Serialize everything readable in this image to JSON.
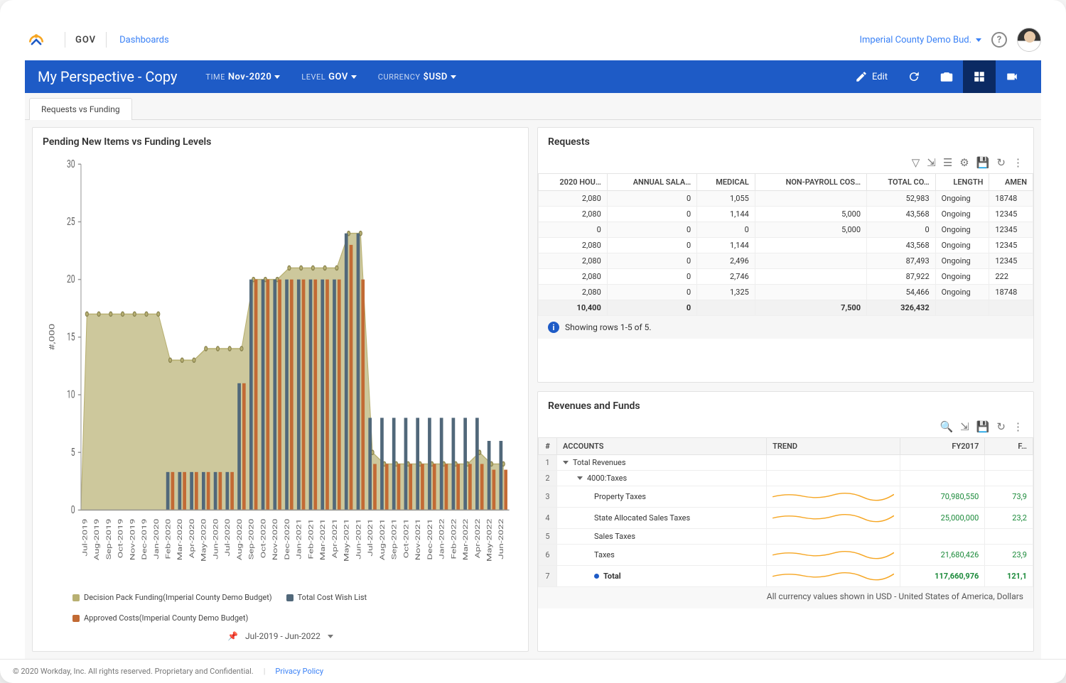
{
  "header": {
    "brand": "GOV",
    "breadcrumb": "Dashboards",
    "instance": "Imperial County Demo Bud."
  },
  "bluebar": {
    "title": "My Perspective - Copy",
    "filters": {
      "time": {
        "label": "TIME",
        "value": "Nov-2020"
      },
      "level": {
        "label": "LEVEL",
        "value": "GOV"
      },
      "currency": {
        "label": "CURRENCY",
        "value": "$USD"
      }
    },
    "edit_label": "Edit"
  },
  "tabs": {
    "active": "Requests vs Funding"
  },
  "chart_panel": {
    "title": "Pending New Items vs Funding Levels",
    "date_range": "Jul-2019 - Jun-2022",
    "legend": {
      "decision": "Decision Pack Funding(Imperial County Demo Budget)",
      "wish": "Total Cost Wish List",
      "approved": "Approved Costs(Imperial County Demo Budget)"
    }
  },
  "chart_data": {
    "type": "bar",
    "ylabel": "#,000",
    "ylim": [
      0,
      30
    ],
    "yticks": [
      0,
      5,
      10,
      15,
      20,
      25,
      30
    ],
    "categories": [
      "Jul-2019",
      "Aug-2019",
      "Sep-2019",
      "Oct-2019",
      "Nov-2019",
      "Dec-2019",
      "Jan-2020",
      "Feb-2020",
      "Mar-2020",
      "Apr-2020",
      "May-2020",
      "Jun-2020",
      "Jul-2020",
      "Aug-2020",
      "Sep-2020",
      "Oct-2020",
      "Nov-2020",
      "Dec-2020",
      "Jan-2021",
      "Feb-2021",
      "Mar-2021",
      "Apr-2021",
      "May-2021",
      "Jun-2021",
      "Jul-2021",
      "Aug-2021",
      "Sep-2021",
      "Oct-2021",
      "Nov-2021",
      "Dec-2021",
      "Jan-2022",
      "Feb-2022",
      "Mar-2022",
      "Apr-2022",
      "May-2022",
      "Jun-2022"
    ],
    "series": [
      {
        "name": "Decision Pack Funding(Imperial County Demo Budget)",
        "type": "area",
        "color": "#b8b072",
        "values": [
          17,
          17,
          17,
          17,
          17,
          17,
          17,
          13,
          13,
          13,
          14,
          14,
          14,
          14,
          20,
          20,
          20,
          21,
          21,
          21,
          21,
          21,
          24,
          24,
          5,
          4,
          4,
          4,
          4,
          4,
          4,
          4,
          4,
          5,
          4,
          4
        ]
      },
      {
        "name": "Total Cost Wish List",
        "type": "bar",
        "color": "#51687a",
        "values": [
          0,
          0,
          0,
          0,
          0,
          0,
          0,
          3.3,
          3.3,
          3.3,
          3.3,
          3.3,
          3.3,
          11,
          20,
          20,
          20,
          20,
          20,
          20,
          20,
          20,
          24,
          24,
          8,
          8,
          8,
          8,
          8,
          8,
          8,
          8,
          8,
          8,
          6,
          6
        ]
      },
      {
        "name": "Approved Costs(Imperial County Demo Budget)",
        "type": "bar",
        "color": "#c26a34",
        "values": [
          0,
          0,
          0,
          0,
          0,
          0,
          0,
          3.3,
          3.3,
          3.3,
          3.3,
          3.3,
          3.3,
          11,
          20,
          20,
          20,
          20,
          20,
          20,
          20,
          20,
          23,
          20,
          4,
          4,
          4,
          4,
          4,
          4,
          4,
          4,
          4,
          4,
          3.5,
          3.5
        ]
      }
    ]
  },
  "requests": {
    "title": "Requests",
    "columns": [
      "2020 HOU…",
      "ANNUAL SALA…",
      "MEDICAL",
      "NON-PAYROLL COS…",
      "TOTAL CO…",
      "LENGTH",
      "AMEN"
    ],
    "rows": [
      {
        "hours": "2,080",
        "salary": "0",
        "medical": "1,055",
        "nonpayroll": "",
        "total": "52,983",
        "length": "Ongoing",
        "amen": "18748"
      },
      {
        "hours": "2,080",
        "salary": "0",
        "medical": "1,144",
        "nonpayroll": "5,000",
        "total": "43,568",
        "length": "Ongoing",
        "amen": "12345"
      },
      {
        "hours": "0",
        "salary": "0",
        "medical": "0",
        "nonpayroll": "5,000",
        "total": "0",
        "length": "Ongoing",
        "amen": "12345"
      },
      {
        "hours": "2,080",
        "salary": "0",
        "medical": "1,144",
        "nonpayroll": "",
        "total": "43,568",
        "length": "Ongoing",
        "amen": "12345"
      },
      {
        "hours": "2,080",
        "salary": "0",
        "medical": "2,496",
        "nonpayroll": "",
        "total": "87,493",
        "length": "Ongoing",
        "amen": "12345"
      },
      {
        "hours": "2,080",
        "salary": "0",
        "medical": "2,746",
        "nonpayroll": "",
        "total": "87,922",
        "length": "Ongoing",
        "amen": "222"
      },
      {
        "hours": "2,080",
        "salary": "0",
        "medical": "1,325",
        "nonpayroll": "",
        "total": "54,466",
        "length": "Ongoing",
        "amen": "18748"
      }
    ],
    "totals": {
      "hours": "10,400",
      "salary": "0",
      "medical": "",
      "nonpayroll": "7,500",
      "total": "326,432",
      "length": "",
      "amen": ""
    },
    "footer": "Showing rows 1-5 of 5."
  },
  "revenues": {
    "title": "Revenues and Funds",
    "columns": [
      "#",
      "ACCOUNTS",
      "TREND",
      "FY2017",
      "F…"
    ],
    "rows": [
      {
        "n": "1",
        "acct": "Total Revenues",
        "indent": 0,
        "expand": true,
        "fy17": "",
        "fy18": ""
      },
      {
        "n": "2",
        "acct": "4000:Taxes",
        "indent": 1,
        "expand": true,
        "fy17": "",
        "fy18": ""
      },
      {
        "n": "3",
        "acct": "Property Taxes",
        "indent": 2,
        "fy17": "70,980,550",
        "fy18": "73,9"
      },
      {
        "n": "4",
        "acct": "State Allocated Sales Taxes",
        "indent": 2,
        "fy17": "25,000,000",
        "fy18": "23,2"
      },
      {
        "n": "5",
        "acct": "Sales Taxes",
        "indent": 2,
        "fy17": "",
        "fy18": ""
      },
      {
        "n": "6",
        "acct": "Taxes",
        "indent": 2,
        "fy17": "21,680,426",
        "fy18": "23,9"
      },
      {
        "n": "7",
        "acct": "Total",
        "indent": 2,
        "bold": true,
        "fy17": "117,660,976",
        "fy18": "121,1"
      }
    ],
    "footer": "All currency values shown in USD - United States of America, Dollars"
  },
  "footer": {
    "copyright": "© 2020 Workday, Inc. All rights reserved. Proprietary and Confidential.",
    "privacy": "Privacy Policy"
  }
}
